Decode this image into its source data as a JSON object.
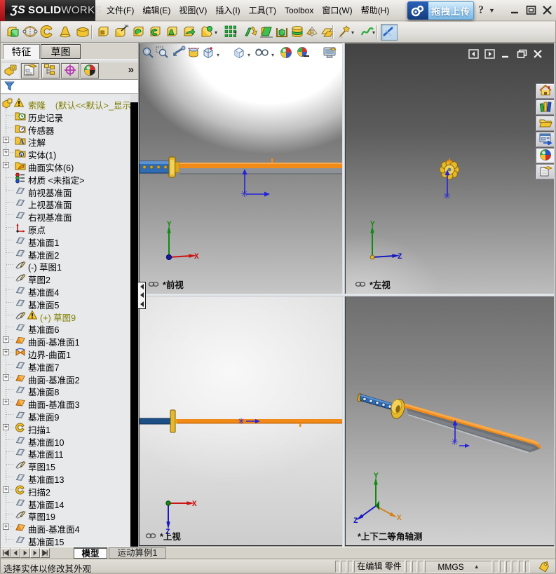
{
  "titlebar": {
    "logo": {
      "prefix": "ƷS",
      "bold": "SOLID",
      "light": "WORKS"
    },
    "menus": [
      {
        "label": "文件(F)"
      },
      {
        "label": "编辑(E)"
      },
      {
        "label": "视图(V)"
      },
      {
        "label": "插入(I)"
      },
      {
        "label": "工具(T)"
      },
      {
        "label": "Toolbox"
      },
      {
        "label": "窗口(W)"
      },
      {
        "label": "帮助(H)"
      }
    ],
    "upload_button": {
      "label": "拖拽上传",
      "logo_icon": "netdisk-logo-icon"
    },
    "help_label": "?",
    "window_buttons": [
      "minimize-icon",
      "maximize-icon",
      "close-icon"
    ]
  },
  "toolbar": {
    "buttons": [
      {
        "icon": "extrude-boss-icon"
      },
      {
        "icon": "revolve-boss-icon"
      },
      {
        "icon": "sweep-boss-icon"
      },
      {
        "icon": "loft-boss-icon"
      },
      {
        "icon": "boundary-boss-icon"
      },
      {
        "icon": "extrude-cut-icon",
        "sep_before": true
      },
      {
        "icon": "hole-wizard-icon"
      },
      {
        "icon": "revolve-cut-icon"
      },
      {
        "icon": "sweep-cut-icon"
      },
      {
        "icon": "loft-cut-icon"
      },
      {
        "icon": "boundary-cut-icon"
      },
      {
        "icon": "fillet-icon",
        "dropdown": true
      },
      {
        "icon": "linear-pattern-icon",
        "dropdown": true
      },
      {
        "icon": "rib-icon"
      },
      {
        "icon": "draft-icon"
      },
      {
        "icon": "shell-icon"
      },
      {
        "icon": "wrap-icon"
      },
      {
        "icon": "mirror-icon"
      },
      {
        "icon": "ref-geometry-icon"
      },
      {
        "icon": "curves-icon",
        "dropdown": true,
        "sep_before": true
      },
      {
        "icon": "spline-icon",
        "dropdown": true
      },
      {
        "icon": "instant3d-icon",
        "pressed": true,
        "sep_before": true
      }
    ]
  },
  "feature_panel": {
    "tabs": [
      {
        "label": "特征",
        "active": true
      },
      {
        "label": "草图",
        "active": false
      }
    ],
    "manager_tabs": [
      {
        "icon": "featuremanager-icon",
        "active": true
      },
      {
        "icon": "propertymanager-icon"
      },
      {
        "icon": "configurationmanager-icon"
      },
      {
        "icon": "dimxpertmanager-icon"
      },
      {
        "icon": "displaymanager-icon"
      }
    ],
    "overflow_label": "»",
    "filter": {
      "icon": "filter-funnel-icon",
      "value": ""
    },
    "tree": [
      {
        "icon": "part-icon",
        "label": "索隆    (默认<<默认>_显示状态",
        "warn": true,
        "olive": true,
        "root": true
      },
      {
        "icon": "history-folder-icon",
        "label": "历史记录"
      },
      {
        "icon": "sensors-folder-icon",
        "label": "传感器"
      },
      {
        "icon": "annotations-folder-icon",
        "label": "注解",
        "expand": true
      },
      {
        "icon": "solid-bodies-folder-icon",
        "label": "实体(1)",
        "expand": true
      },
      {
        "icon": "surface-bodies-folder-icon",
        "label": "曲面实体(6)",
        "expand": true
      },
      {
        "icon": "material-icon",
        "label": "材质 <未指定>"
      },
      {
        "icon": "plane-icon",
        "label": "前视基准面"
      },
      {
        "icon": "plane-icon",
        "label": "上视基准面"
      },
      {
        "icon": "plane-icon",
        "label": "右视基准面"
      },
      {
        "icon": "origin-icon",
        "label": "原点"
      },
      {
        "icon": "plane-icon",
        "label": "基准面1"
      },
      {
        "icon": "plane-icon",
        "label": "基准面2"
      },
      {
        "icon": "sketch-icon",
        "label": "(-) 草图1"
      },
      {
        "icon": "sketch-icon",
        "label": "草图2"
      },
      {
        "icon": "plane-icon",
        "label": "基准面4"
      },
      {
        "icon": "plane-icon",
        "label": "基准面5"
      },
      {
        "icon": "sketch-icon",
        "label": "(+) 草图9",
        "warn": true,
        "olive": true
      },
      {
        "icon": "plane-icon",
        "label": "基准面6"
      },
      {
        "icon": "surface-plane-icon",
        "label": "曲面-基准面1",
        "expand": true
      },
      {
        "icon": "boundary-surface-icon",
        "label": "边界-曲面1",
        "expand": true
      },
      {
        "icon": "plane-icon",
        "label": "基准面7"
      },
      {
        "icon": "surface-plane-icon",
        "label": "曲面-基准面2",
        "expand": true
      },
      {
        "icon": "plane-icon",
        "label": "基准面8"
      },
      {
        "icon": "surface-plane-icon",
        "label": "曲面-基准面3",
        "expand": true
      },
      {
        "icon": "plane-icon",
        "label": "基准面9"
      },
      {
        "icon": "sweep-feature-icon",
        "label": "扫描1",
        "expand": true
      },
      {
        "icon": "plane-icon",
        "label": "基准面10"
      },
      {
        "icon": "plane-icon",
        "label": "基准面11"
      },
      {
        "icon": "sketch-icon",
        "label": "草图15"
      },
      {
        "icon": "plane-icon",
        "label": "基准面13"
      },
      {
        "icon": "sweep-feature-icon",
        "label": "扫描2",
        "expand": true
      },
      {
        "icon": "plane-icon",
        "label": "基准面14"
      },
      {
        "icon": "sketch-icon",
        "label": "草图19"
      },
      {
        "icon": "surface-plane-icon",
        "label": "曲面-基准面4",
        "expand": true
      },
      {
        "icon": "plane-icon",
        "label": "基准面15"
      }
    ]
  },
  "headsup_toolbar": [
    {
      "icon": "zoom-fit-icon"
    },
    {
      "icon": "zoom-area-icon"
    },
    {
      "icon": "previous-view-icon"
    },
    {
      "icon": "section-view-icon"
    },
    {
      "icon": "view-orientation-icon",
      "dropdown": true
    },
    {
      "icon": "display-style-icon",
      "dropdown": true
    },
    {
      "icon": "hide-show-items-icon",
      "dropdown": true
    },
    {
      "icon": "edit-appearance-icon"
    },
    {
      "icon": "apply-scene-icon"
    },
    {
      "icon": "view-settings-icon"
    }
  ],
  "viewports": {
    "front": {
      "label": "*前视",
      "chain": true
    },
    "left": {
      "label": "*左视",
      "chain": true
    },
    "top": {
      "label": "*上视",
      "chain": true
    },
    "iso": {
      "label": "*上下二等角轴测",
      "chain": false
    },
    "triad_labels": {
      "x": "X",
      "y": "Y",
      "z": "Z"
    },
    "window_buttons": [
      "prev-window-icon",
      "next-window-icon",
      "minimize-icon",
      "restore-icon",
      "close-icon"
    ]
  },
  "taskpane_buttons": [
    {
      "icon": "resources-home-icon"
    },
    {
      "icon": "design-library-icon"
    },
    {
      "icon": "file-explorer-icon"
    },
    {
      "icon": "view-palette-icon"
    },
    {
      "icon": "appearances-icon",
      "pressed": true
    },
    {
      "icon": "custom-properties-icon"
    }
  ],
  "sheet_bar": {
    "nav_icons": [
      "first-sheet-icon",
      "prev-sheet-icon",
      "next-sheet-icon",
      "next-sheet-icon",
      "last-sheet-icon"
    ],
    "tabs": [
      {
        "label": "模型",
        "active": true
      },
      {
        "label": "运动算例1",
        "active": false
      }
    ]
  },
  "statusbar": {
    "message": "选择实体以修改其外观",
    "editing_state": "在编辑 零件",
    "units": "MMGS",
    "tag_icon": "tag-icon"
  },
  "colors": {
    "blade_orange": "#f28a18",
    "handle_blue": "#2e6cb4",
    "tsuba_gold": "#e5b92a",
    "olive_text": "#7e7e00",
    "upload_blue": "#7db9e8",
    "logo_red": "#9c0e14"
  }
}
